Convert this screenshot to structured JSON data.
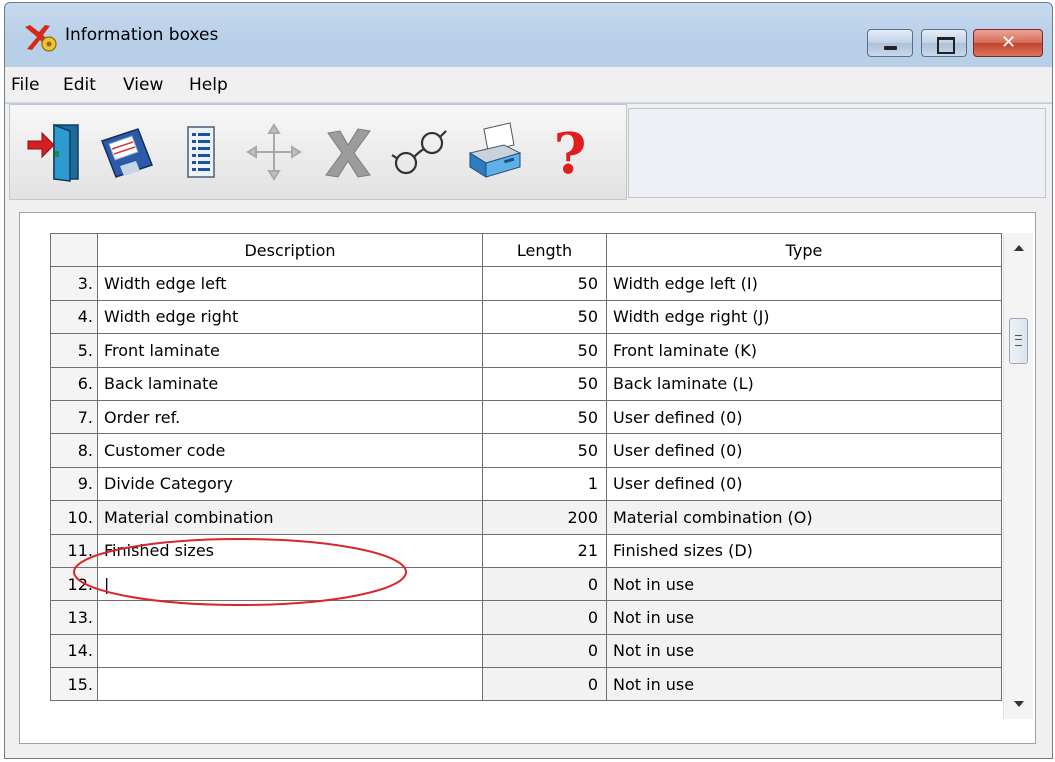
{
  "window": {
    "title": "Information boxes",
    "controls": {
      "minimize": "minimize-icon",
      "maximize": "maximize-icon",
      "close": "close-icon"
    }
  },
  "menu": [
    "File",
    "Edit",
    "View",
    "Help"
  ],
  "toolbar": {
    "buttons": [
      "exit-door-icon",
      "save-floppy-icon",
      "list-icon",
      "move-arrows-icon",
      "delete-cross-icon",
      "glasses-icon",
      "printer-icon",
      "help-question-icon"
    ]
  },
  "grid": {
    "columns": [
      "",
      "Description",
      "Length",
      "Type"
    ],
    "rows": [
      {
        "num": "3.",
        "description": "Width edge left",
        "length": "50",
        "type": "Width edge left (I)"
      },
      {
        "num": "4.",
        "description": "Width edge right",
        "length": "50",
        "type": "Width edge right (J)"
      },
      {
        "num": "5.",
        "description": "Front laminate",
        "length": "50",
        "type": "Front laminate (K)"
      },
      {
        "num": "6.",
        "description": "Back laminate",
        "length": "50",
        "type": "Back laminate (L)"
      },
      {
        "num": "7.",
        "description": "Order ref.",
        "length": "50",
        "type": "User defined (0)"
      },
      {
        "num": "8.",
        "description": "Customer code",
        "length": "50",
        "type": "User defined (0)"
      },
      {
        "num": "9.",
        "description": "Divide Category",
        "length": "1",
        "type": "User defined (0)"
      },
      {
        "num": "10.",
        "description": "Material combination",
        "length": "200",
        "type": "Material combination (O)"
      },
      {
        "num": "11.",
        "description": "Finished sizes",
        "length": "21",
        "type": "Finished sizes (D)"
      },
      {
        "num": "12.",
        "description": "|",
        "length": "0",
        "type": "Not in use"
      },
      {
        "num": "13.",
        "description": "",
        "length": "0",
        "type": "Not in use"
      },
      {
        "num": "14.",
        "description": "",
        "length": "0",
        "type": "Not in use"
      },
      {
        "num": "15.",
        "description": "",
        "length": "0",
        "type": "Not in use"
      }
    ]
  },
  "colors": {
    "highlight_circle": "#d9262b",
    "title_bar": "#b8cfe8",
    "close_button": "#c1432c"
  }
}
